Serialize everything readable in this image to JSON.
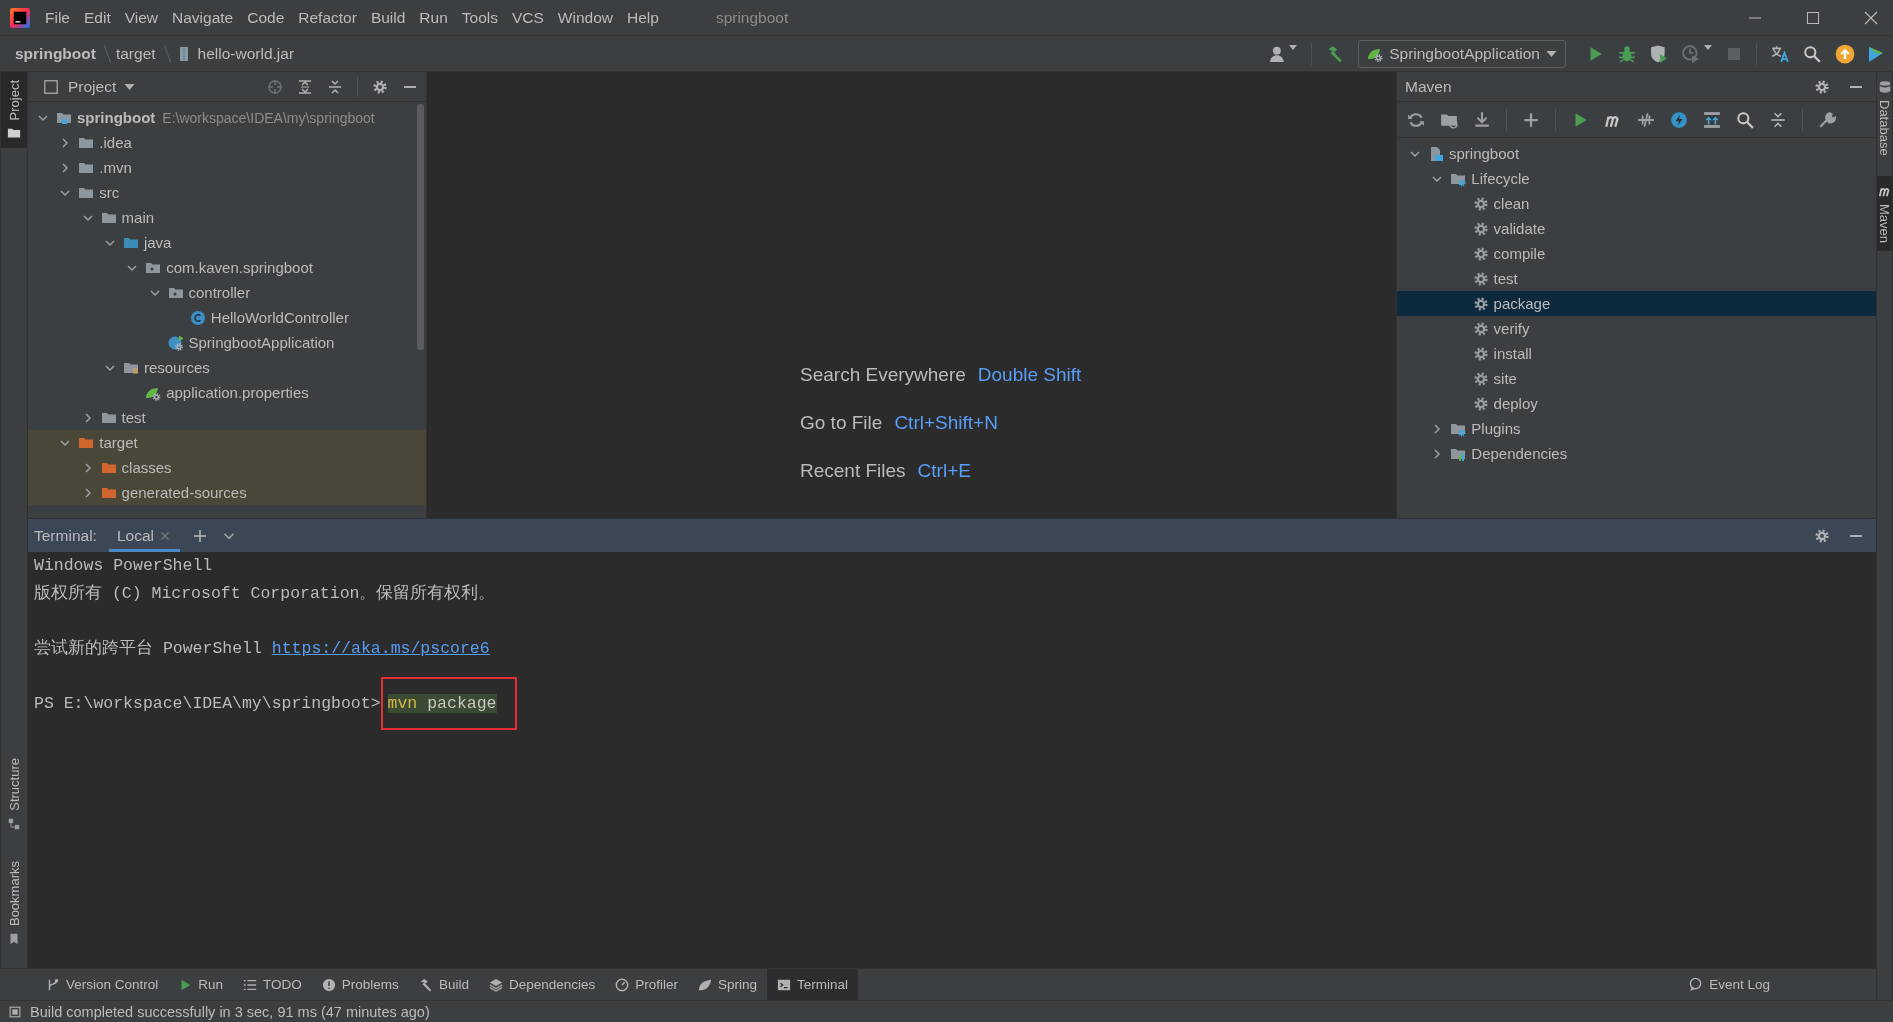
{
  "menu_bar": {
    "items": [
      "File",
      "Edit",
      "View",
      "Navigate",
      "Code",
      "Refactor",
      "Build",
      "Run",
      "Tools",
      "VCS",
      "Window",
      "Help"
    ],
    "title": "springboot"
  },
  "navigation_bar": {
    "breadcrumbs": [
      {
        "label": "springboot",
        "kind": "project"
      },
      {
        "label": "target",
        "kind": "folder"
      },
      {
        "label": "hello-world.jar",
        "kind": "jar"
      }
    ],
    "run_configuration": "SpringbootApplication"
  },
  "left_stripe": [
    {
      "label": "Project",
      "kind": "project",
      "selected": true
    },
    {
      "label": "Structure",
      "kind": "structure",
      "selected": false
    },
    {
      "label": "Bookmarks",
      "kind": "bookmarks",
      "selected": false
    }
  ],
  "right_stripe": [
    {
      "label": "Database",
      "kind": "database",
      "selected": false
    },
    {
      "label": "Maven",
      "kind": "maven",
      "selected": true
    }
  ],
  "project_panel": {
    "title": "Project",
    "tree": [
      {
        "label": "springboot",
        "kind": "module",
        "path": "E:\\workspace\\IDEA\\my\\springboot",
        "expanded": true,
        "excluded": false,
        "children": [
          {
            "label": ".idea",
            "kind": "folder",
            "expanded": false,
            "excluded": false
          },
          {
            "label": ".mvn",
            "kind": "folder",
            "expanded": false,
            "excluded": false
          },
          {
            "label": "src",
            "kind": "folder",
            "expanded": true,
            "excluded": false,
            "children": [
              {
                "label": "main",
                "kind": "folder",
                "expanded": true,
                "excluded": false,
                "children": [
                  {
                    "label": "java",
                    "kind": "source-folder",
                    "expanded": true,
                    "excluded": false,
                    "children": [
                      {
                        "label": "com.kaven.springboot",
                        "kind": "package",
                        "expanded": true,
                        "excluded": false,
                        "children": [
                          {
                            "label": "controller",
                            "kind": "package",
                            "expanded": true,
                            "excluded": false,
                            "children": [
                              {
                                "label": "HelloWorldController",
                                "kind": "class",
                                "excluded": false
                              }
                            ]
                          },
                          {
                            "label": "SpringbootApplication",
                            "kind": "spring-class",
                            "excluded": false
                          }
                        ]
                      }
                    ]
                  },
                  {
                    "label": "resources",
                    "kind": "resources",
                    "expanded": true,
                    "excluded": false,
                    "children": [
                      {
                        "label": "application.properties",
                        "kind": "spring-config",
                        "excluded": false
                      }
                    ]
                  }
                ]
              },
              {
                "label": "test",
                "kind": "folder",
                "expanded": false,
                "excluded": false
              }
            ]
          },
          {
            "label": "target",
            "kind": "excluded-folder",
            "expanded": true,
            "excluded": true,
            "children": [
              {
                "label": "classes",
                "kind": "excluded-folder",
                "expanded": false,
                "excluded": true
              },
              {
                "label": "generated-sources",
                "kind": "excluded-folder",
                "expanded": false,
                "excluded": true
              }
            ]
          }
        ]
      }
    ]
  },
  "editor_hints": [
    {
      "action": "Search Everywhere",
      "shortcut": "Double Shift"
    },
    {
      "action": "Go to File",
      "shortcut": "Ctrl+Shift+N"
    },
    {
      "action": "Recent Files",
      "shortcut": "Ctrl+E"
    }
  ],
  "maven_panel": {
    "title": "Maven",
    "tree": [
      {
        "label": "springboot",
        "kind": "maven-project",
        "expanded": true,
        "selected": false,
        "children": [
          {
            "label": "Lifecycle",
            "kind": "lifecycle",
            "expanded": true,
            "selected": false,
            "children": [
              {
                "label": "clean",
                "kind": "goal",
                "selected": false
              },
              {
                "label": "validate",
                "kind": "goal",
                "selected": false
              },
              {
                "label": "compile",
                "kind": "goal",
                "selected": false
              },
              {
                "label": "test",
                "kind": "goal",
                "selected": false
              },
              {
                "label": "package",
                "kind": "goal",
                "selected": true
              },
              {
                "label": "verify",
                "kind": "goal",
                "selected": false
              },
              {
                "label": "install",
                "kind": "goal",
                "selected": false
              },
              {
                "label": "site",
                "kind": "goal",
                "selected": false
              },
              {
                "label": "deploy",
                "kind": "goal",
                "selected": false
              }
            ]
          },
          {
            "label": "Plugins",
            "kind": "lifecycle",
            "expanded": false,
            "selected": false
          },
          {
            "label": "Dependencies",
            "kind": "dependencies",
            "expanded": false,
            "selected": false
          }
        ]
      }
    ]
  },
  "terminal": {
    "title": "Terminal:",
    "tabs": [
      {
        "label": "Local",
        "selected": true
      }
    ],
    "lines": [
      {
        "kind": "output",
        "text": "Windows PowerShell"
      },
      {
        "kind": "output",
        "text": "版权所有 (C) Microsoft Corporation。保留所有权利。"
      },
      {
        "kind": "output",
        "blank_before": true,
        "text": "尝试新的跨平台 PowerShell",
        "link": "https://aka.ms/pscore6"
      },
      {
        "kind": "prompt",
        "blank_before": true,
        "text": "PS E:\\workspace\\IDEA\\my\\springboot>",
        "command": "mvn",
        "argument": "package",
        "annotated": true
      }
    ]
  },
  "tool_windows": [
    {
      "label": "Version Control",
      "kind": "vcs",
      "selected": false
    },
    {
      "label": "Run",
      "kind": "run",
      "selected": false
    },
    {
      "label": "TODO",
      "kind": "todo",
      "selected": false
    },
    {
      "label": "Problems",
      "kind": "problems",
      "selected": false
    },
    {
      "label": "Build",
      "kind": "build",
      "selected": false
    },
    {
      "label": "Dependencies",
      "kind": "dependencies",
      "selected": false
    },
    {
      "label": "Profiler",
      "kind": "profiler",
      "selected": false
    },
    {
      "label": "Spring",
      "kind": "spring",
      "selected": false
    },
    {
      "label": "Terminal",
      "kind": "terminal",
      "selected": true
    }
  ],
  "event_log": "Event Log",
  "status": "Build completed successfully in 3 sec, 91 ms (47 minutes ago)"
}
